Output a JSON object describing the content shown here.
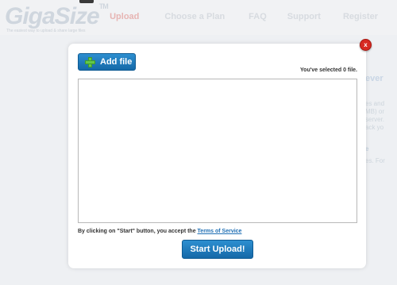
{
  "background": {
    "logo": "GigaSize",
    "logo_tm": "TM",
    "tagline": "The easiest way to upload & share large files",
    "nav": [
      {
        "label": "Upload",
        "active": true
      },
      {
        "label": "Choose a Plan",
        "active": false
      },
      {
        "label": "FAQ",
        "active": false
      },
      {
        "label": "Support",
        "active": false
      },
      {
        "label": "Register",
        "active": false
      }
    ],
    "side": {
      "heading": "ever",
      "lines": [
        "es and",
        "MB) or",
        "server.",
        "ack yo"
      ],
      "link": "e",
      "link2": "es. For"
    }
  },
  "modal": {
    "close_label": "x",
    "add_file_label": "Add file",
    "selected_text": "You've selected 0 file.",
    "terms_prefix": "By clicking on \"Start\" button, you accept the ",
    "terms_link": "Terms of Service",
    "start_label": "Start Upload!"
  },
  "colors": {
    "accent_blue": "#1a76bb",
    "close_red": "#d72a23",
    "plus_green": "#62c84a"
  }
}
